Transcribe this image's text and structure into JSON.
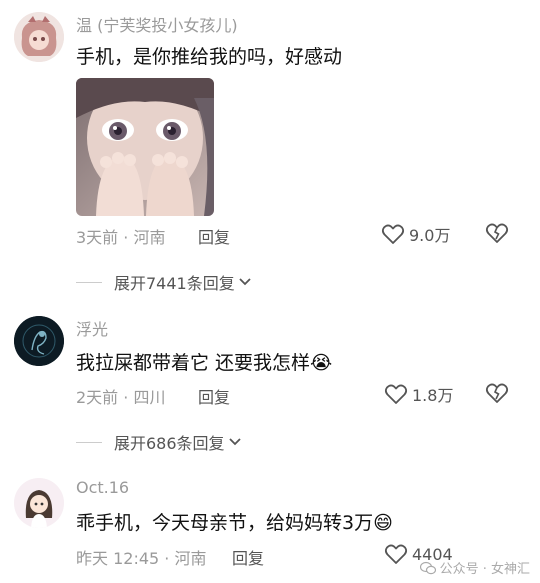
{
  "comments": [
    {
      "username": "温 (宁芙奖投小女孩儿)",
      "text": "手机，是你推给我的吗，好感动",
      "meta": "3天前 · 河南",
      "reply": "回复",
      "likes": "9.0万",
      "expand": "展开7441条回复"
    },
    {
      "username": "浮光",
      "text": "我拉屎都带着它 还要我怎样😭",
      "meta": "2天前 · 四川",
      "reply": "回复",
      "likes": "1.8万",
      "expand": "展开686条回复"
    },
    {
      "username": "Oct.16",
      "text": "乖手机，今天母亲节，给妈妈转3万😄",
      "meta": "昨天 12:45 · 河南",
      "reply": "回复",
      "likes": "4404"
    }
  ],
  "watermark": "公众号 · 女神汇",
  "colors": {
    "muted": "#9a9a9a",
    "text": "#111111",
    "accent": "#555555"
  }
}
